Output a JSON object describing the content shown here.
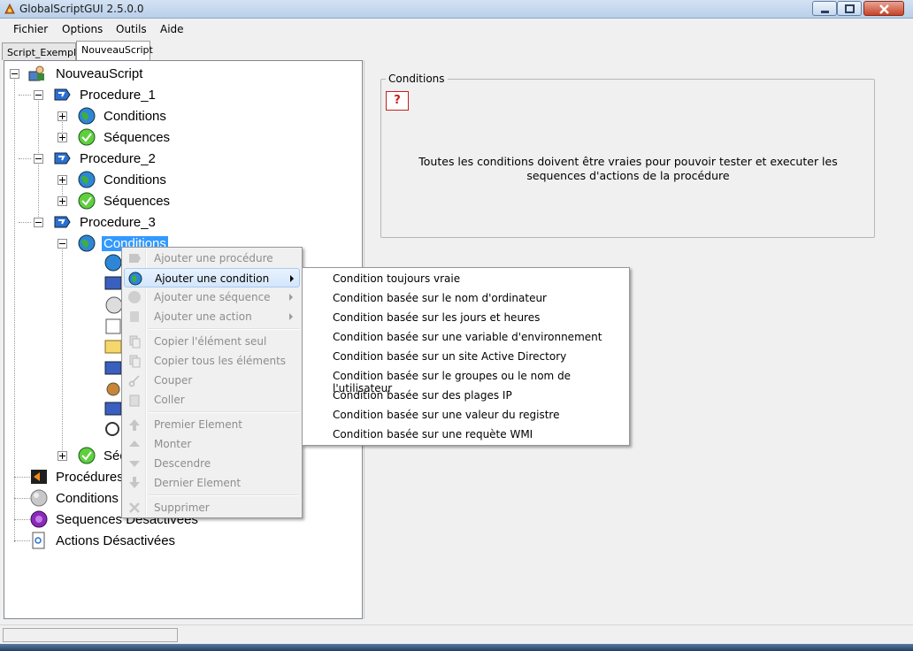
{
  "window": {
    "title": "GlobalScriptGUI 2.5.0.0"
  },
  "menubar": {
    "items": [
      "Fichier",
      "Options",
      "Outils",
      "Aide"
    ]
  },
  "tabs": [
    "Script_Exemple",
    "NouveauScript"
  ],
  "tree": {
    "root": "NouveauScript",
    "procedure_1": "Procedure_1",
    "procedure_2": "Procedure_2",
    "procedure_3": "Procedure_3",
    "conditions": "Conditions",
    "sequences": "Séquences",
    "sequences_short": "Séq",
    "procedures_disabled": "Procédures",
    "conditions_disabled": "Conditions",
    "sequences_disabled": "Sequences Désactivées",
    "actions_disabled": "Actions Désactivées"
  },
  "conditions_panel": {
    "group_title": "Conditions",
    "help_icon": "?",
    "description_line1": "Toutes les conditions doivent être vraies pour pouvoir tester et executer les",
    "description_line2": "sequences d'actions de la procédure"
  },
  "context_menu": {
    "items": [
      {
        "label": "Ajouter une procédure",
        "enabled": false,
        "icon": "procedure-icon"
      },
      {
        "label": "Ajouter une condition",
        "enabled": true,
        "highlighted": true,
        "submenu": true,
        "icon": "globe-icon"
      },
      {
        "label": "Ajouter une séquence",
        "enabled": false,
        "submenu": true,
        "icon": "sequence-icon"
      },
      {
        "label": "Ajouter une action",
        "enabled": false,
        "submenu": true,
        "icon": "action-icon"
      },
      {
        "label": "Copier l'élément seul",
        "enabled": false,
        "icon": "copy-icon"
      },
      {
        "label": "Copier tous les éléments",
        "enabled": false,
        "icon": "copy-all-icon"
      },
      {
        "label": "Couper",
        "enabled": false,
        "icon": "scissors-icon"
      },
      {
        "label": "Coller",
        "enabled": false,
        "icon": "paste-icon"
      },
      {
        "label": "Premier Element",
        "enabled": false,
        "icon": "arrow-top-icon"
      },
      {
        "label": "Monter",
        "enabled": false,
        "icon": "arrow-up-icon"
      },
      {
        "label": "Descendre",
        "enabled": false,
        "icon": "arrow-down-icon"
      },
      {
        "label": "Dernier Element",
        "enabled": false,
        "icon": "arrow-bottom-icon"
      },
      {
        "label": "Supprimer",
        "enabled": false,
        "icon": "delete-icon"
      }
    ]
  },
  "submenu": {
    "items": [
      "Condition toujours vraie",
      "Condition basée sur le nom d'ordinateur",
      "Condition basée sur les jours et heures",
      "Condition basée sur une variable d'environnement",
      "Condition basée sur un site Active Directory",
      "Condition basée sur le groupes ou le nom de l'utilisateur",
      "Condition basée sur des plages IP",
      "Condition basée sur une valeur du registre",
      "Condition basée sur une requète WMI"
    ]
  },
  "colors": {
    "selection": "#3399ff",
    "menu_highlight": "#d3e6fb",
    "help_red": "#c81e1e"
  }
}
